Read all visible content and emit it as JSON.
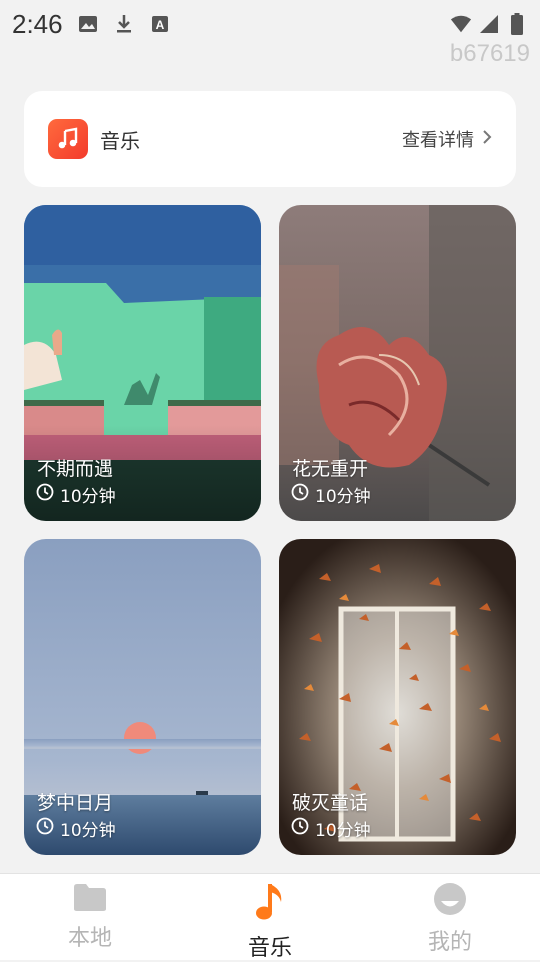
{
  "status_bar": {
    "time": "2:46",
    "icons": [
      "image-icon",
      "download-icon",
      "text-a-icon",
      "wifi-icon",
      "signal-icon",
      "battery-icon"
    ]
  },
  "watermark": "b67619",
  "music_card": {
    "icon": "music-note-icon",
    "title": "音乐",
    "details_label": "查看详情",
    "accent": "#f4492f"
  },
  "tiles": [
    {
      "title": "不期而遇",
      "duration": "10分钟"
    },
    {
      "title": "花无重开",
      "duration": "10分钟"
    },
    {
      "title": "梦中日月",
      "duration": "10分钟"
    },
    {
      "title": "破灭童话",
      "duration": "10分钟"
    }
  ],
  "bottom_nav": {
    "items": [
      {
        "label": "本地",
        "icon": "folder-icon",
        "active": false
      },
      {
        "label": "音乐",
        "icon": "music-note-icon",
        "active": true
      },
      {
        "label": "我的",
        "icon": "profile-icon",
        "active": false
      }
    ],
    "active_color": "#ff7a1a",
    "inactive_color": "#c8c8c8"
  }
}
